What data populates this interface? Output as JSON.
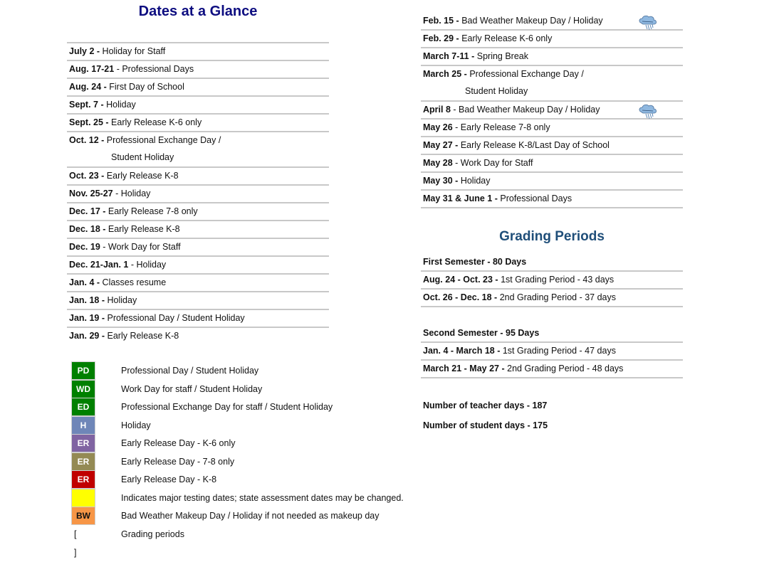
{
  "left": {
    "title": "Dates at a Glance",
    "entries": [
      {
        "date": "July 2 -",
        "desc": " Holiday for Staff"
      },
      {
        "date": "Aug. 17-21",
        "desc": " - Professional Days"
      },
      {
        "date": "Aug. 24 -",
        "desc": " First Day of School"
      },
      {
        "date": "Sept. 7 -",
        "desc": " Holiday"
      },
      {
        "date": "Sept. 25 -",
        "desc": " Early Release K-6 only"
      },
      {
        "date": "Oct. 12 -",
        "desc": " Professional Exchange Day /",
        "cont": "Student Holiday"
      },
      {
        "date": "Oct. 23 -",
        "desc": " Early Release K-8"
      },
      {
        "date": "Nov. 25-27",
        "desc": " - Holiday"
      },
      {
        "date": "Dec. 17 -",
        "desc": " Early Release 7-8 only"
      },
      {
        "date": "Dec. 18 -",
        "desc": " Early Release K-8"
      },
      {
        "date": "Dec. 19",
        "desc": " - Work Day for Staff"
      },
      {
        "date": "Dec. 21-Jan. 1",
        "desc": " - Holiday"
      },
      {
        "date": "Jan. 4 -",
        "desc": " Classes resume"
      },
      {
        "date": "Jan. 18 -",
        "desc": " Holiday"
      },
      {
        "date": "Jan. 19 -",
        "desc": " Professional Day / Student Holiday"
      },
      {
        "date": "Jan. 29 -",
        "desc": " Early Release K-8"
      }
    ]
  },
  "legend": [
    {
      "code": "PD",
      "color": "#008000",
      "text": "Professional Day / Student Holiday"
    },
    {
      "code": "WD",
      "color": "#008000",
      "text": "Work Day for staff / Student Holiday"
    },
    {
      "code": "ED",
      "color": "#008000",
      "text": "Professional Exchange Day for staff / Student Holiday"
    },
    {
      "code": "H",
      "color": "#6f86b8",
      "text": "Holiday"
    },
    {
      "code": "ER",
      "color": "#8064a2",
      "text": "Early Release Day - K-6 only"
    },
    {
      "code": "ER",
      "color": "#948a54",
      "text": "Early Release Day - 7-8 only"
    },
    {
      "code": "ER",
      "color": "#c00000",
      "text": "Early Release Day - K-8"
    },
    {
      "code": "",
      "color": "#ffff00",
      "text": "Indicates major testing dates; state assessment dates may be changed."
    },
    {
      "code": "BW",
      "color": "#f79646",
      "text": "Bad Weather Makeup Day / Holiday if not needed as makeup day",
      "dark": true
    },
    {
      "code": "[ ]",
      "color": "",
      "text": "Grading periods",
      "bracket": true
    }
  ],
  "right": {
    "entries": [
      {
        "date": "Feb. 15 -",
        "desc": " Bad Weather Makeup Day / Holiday",
        "icon": "storm-cloud-icon"
      },
      {
        "date": "Feb. 29 -",
        "desc": " Early Release K-6 only"
      },
      {
        "date": "March 7-11 -",
        "desc": " Spring Break"
      },
      {
        "date": "March 25 -",
        "desc": " Professional Exchange Day /",
        "cont": "Student Holiday"
      },
      {
        "date": "April 8",
        "desc": " - Bad Weather Makeup Day / Holiday",
        "icon": "storm-cloud-icon"
      },
      {
        "date": "May 26",
        "desc": " - Early Release 7-8 only"
      },
      {
        "date": "May 27 -",
        "desc": " Early Release K-8/Last Day of School"
      },
      {
        "date": "May  28",
        "desc": " - Work Day for Staff"
      },
      {
        "date": "May 30 -",
        "desc": " Holiday"
      },
      {
        "date": "May 31 & June 1 -",
        "desc": " Professional Days"
      }
    ],
    "grading_title": "Grading Periods",
    "first_semester": {
      "heading": "First Semester - 80 Days",
      "periods": [
        {
          "range": "Aug. 24 - Oct. 23 -",
          "desc": " 1st Grading Period - 43 days"
        },
        {
          "range": "Oct. 26 - Dec. 18 -",
          "desc": " 2nd Grading Period - 37 days"
        }
      ]
    },
    "second_semester": {
      "heading": "Second Semester - 95 Days",
      "periods": [
        {
          "range": "Jan. 4 - March 18 -",
          "desc": " 1st Grading Period - 47 days"
        },
        {
          "range": "March 21 - May 27 -",
          "desc": " 2nd Grading Period - 48 days"
        }
      ]
    },
    "teacher_days": "Number of teacher days - 187",
    "student_days": "Number of student days - 175"
  }
}
